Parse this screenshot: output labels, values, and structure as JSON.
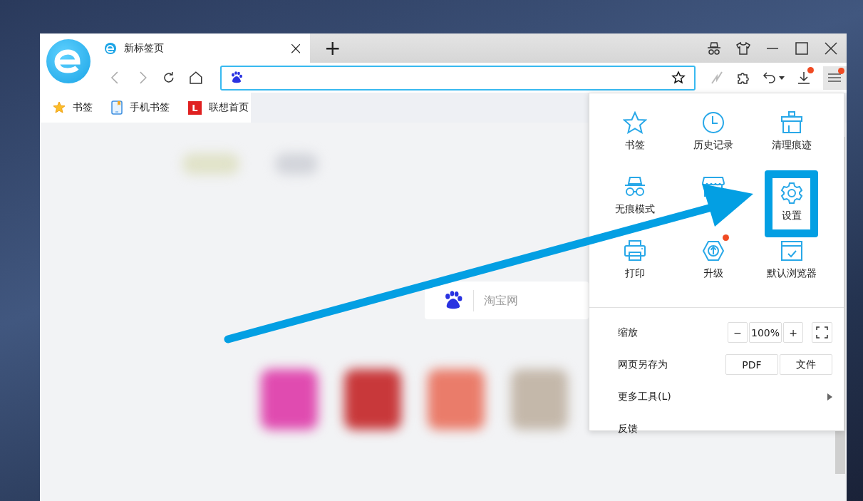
{
  "tab": {
    "title": "新标签页",
    "close": "×",
    "new_tab": "+"
  },
  "toolbar": {
    "download_badge": true,
    "menu_badge": true
  },
  "bookmarks": [
    {
      "label": "书签",
      "kind": "star"
    },
    {
      "label": "手机书签",
      "kind": "phone"
    },
    {
      "label": "联想首页",
      "kind": "lenovo",
      "badge_letter": "L"
    }
  ],
  "search": {
    "placeholder": "淘宝网"
  },
  "menu": {
    "grid": [
      {
        "label": "书签",
        "kind": "star",
        "highlighted": false,
        "badge": false
      },
      {
        "label": "历史记录",
        "kind": "clock",
        "highlighted": false,
        "badge": false
      },
      {
        "label": "清理痕迹",
        "kind": "cleaner",
        "highlighted": false,
        "badge": false
      },
      {
        "label": "无痕模式",
        "kind": "incognito",
        "highlighted": false,
        "badge": false
      },
      {
        "kind": "store",
        "highlighted": false,
        "badge": false
      },
      {
        "label": "设置",
        "kind": "gear",
        "highlighted": true,
        "badge": false
      },
      {
        "label": "打印",
        "kind": "printer",
        "highlighted": false,
        "badge": false
      },
      {
        "label": "升级",
        "kind": "upgrade",
        "highlighted": false,
        "badge": true
      },
      {
        "label": "默认浏览器",
        "kind": "default",
        "highlighted": false,
        "badge": false
      }
    ],
    "zoom": {
      "label": "缩放",
      "minus": "−",
      "value": "100%",
      "plus": "+"
    },
    "save_as": {
      "label": "网页另存为",
      "buttons": [
        "PDF",
        "文件"
      ]
    },
    "more_tools": {
      "label": "更多工具(L)"
    },
    "feedback": {
      "label": "反馈"
    }
  }
}
